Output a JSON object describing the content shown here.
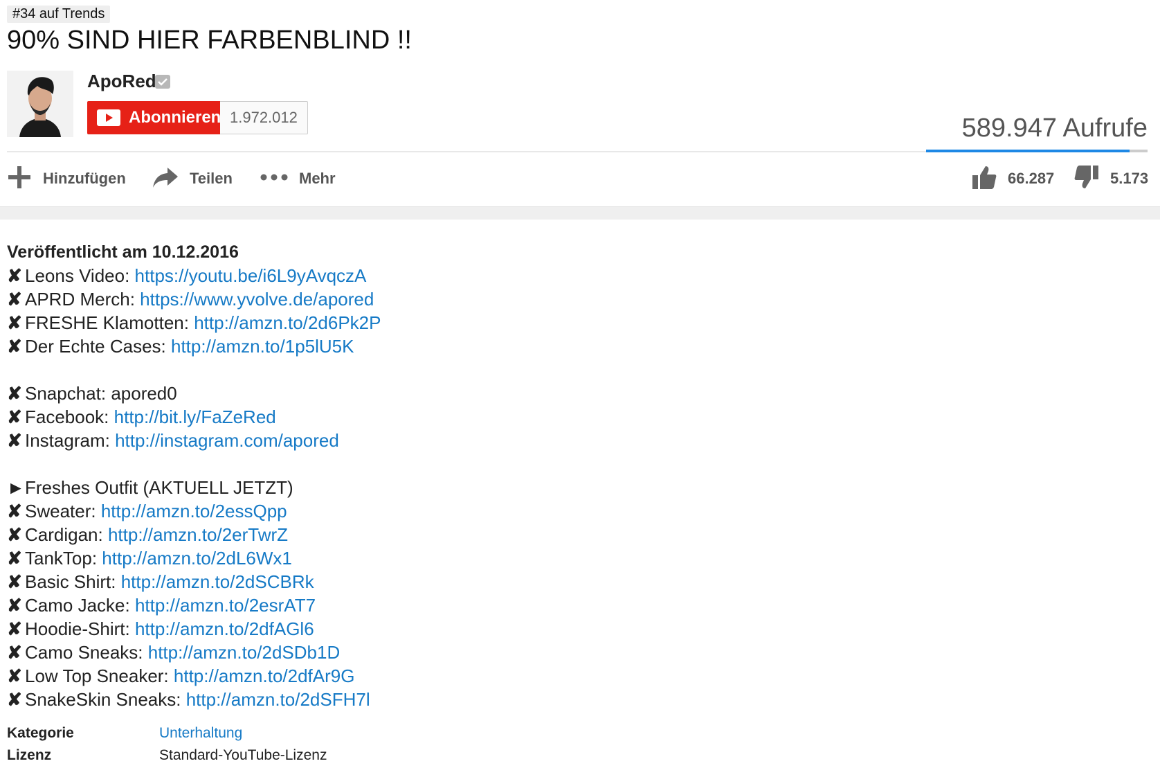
{
  "trend_badge": "#34 auf Trends",
  "title": "90% SIND HIER FARBENBLIND !!",
  "channel": {
    "name": "ApoRed",
    "subscribe_label": "Abonnieren",
    "subscriber_count": "1.972.012"
  },
  "views": "589.947 Aufrufe",
  "actions": {
    "add": "Hinzufügen",
    "share": "Teilen",
    "more": "Mehr",
    "likes": "66.287",
    "dislikes": "5.173"
  },
  "colors": {
    "subscribe_red": "#e62117",
    "link_blue": "#167ac6",
    "sentiment_blue": "#1e88e5"
  },
  "icons": [
    "verified-icon",
    "youtube-play-icon",
    "plus-icon",
    "share-arrow-icon",
    "more-dots-icon",
    "thumbs-up-icon",
    "thumbs-down-icon"
  ],
  "description": {
    "published": "Veröffentlicht am 10.12.2016",
    "lines": [
      {
        "mark": "✘",
        "text": "Leons Video: ",
        "link": "https://youtu.be/i6L9yAvqczA"
      },
      {
        "mark": "✘",
        "text": "APRD Merch: ",
        "link": "https://www.yvolve.de/apored"
      },
      {
        "mark": "✘",
        "text": "FRESHE Klamotten: ",
        "link": "http://amzn.to/2d6Pk2P"
      },
      {
        "mark": "✘",
        "text": "Der Echte Cases: ",
        "link": "http://amzn.to/1p5lU5K"
      },
      {
        "blank": true
      },
      {
        "mark": "✘",
        "text": "Snapchat: apored0",
        "link": ""
      },
      {
        "mark": "✘",
        "text": "Facebook: ",
        "link": "http://bit.ly/FaZeRed"
      },
      {
        "mark": "✘",
        "text": "Instagram: ",
        "link": "http://instagram.com/apored"
      },
      {
        "blank": true
      },
      {
        "mark": "►",
        "text": "Freshes Outfit (AKTUELL JETZT)",
        "link": ""
      },
      {
        "mark": "✘",
        "text": "Sweater: ",
        "link": "http://amzn.to/2essQpp"
      },
      {
        "mark": "✘",
        "text": "Cardigan: ",
        "link": "http://amzn.to/2erTwrZ"
      },
      {
        "mark": "✘",
        "text": "TankTop: ",
        "link": "http://amzn.to/2dL6Wx1"
      },
      {
        "mark": "✘",
        "text": "Basic Shirt: ",
        "link": "http://amzn.to/2dSCBRk"
      },
      {
        "mark": "✘",
        "text": "Camo Jacke: ",
        "link": "http://amzn.to/2esrAT7"
      },
      {
        "mark": "✘",
        "text": "Hoodie-Shirt: ",
        "link": "http://amzn.to/2dfAGl6"
      },
      {
        "mark": "✘",
        "text": "Camo Sneaks: ",
        "link": "http://amzn.to/2dSDb1D"
      },
      {
        "mark": "✘",
        "text": "Low Top Sneaker: ",
        "link": "http://amzn.to/2dfAr9G"
      },
      {
        "mark": "✘",
        "text": "SnakeSkin Sneaks: ",
        "link": "http://amzn.to/2dSFH7l"
      }
    ]
  },
  "meta": {
    "category_label": "Kategorie",
    "category_value": "Unterhaltung",
    "license_label": "Lizenz",
    "license_value": "Standard-YouTube-Lizenz"
  }
}
